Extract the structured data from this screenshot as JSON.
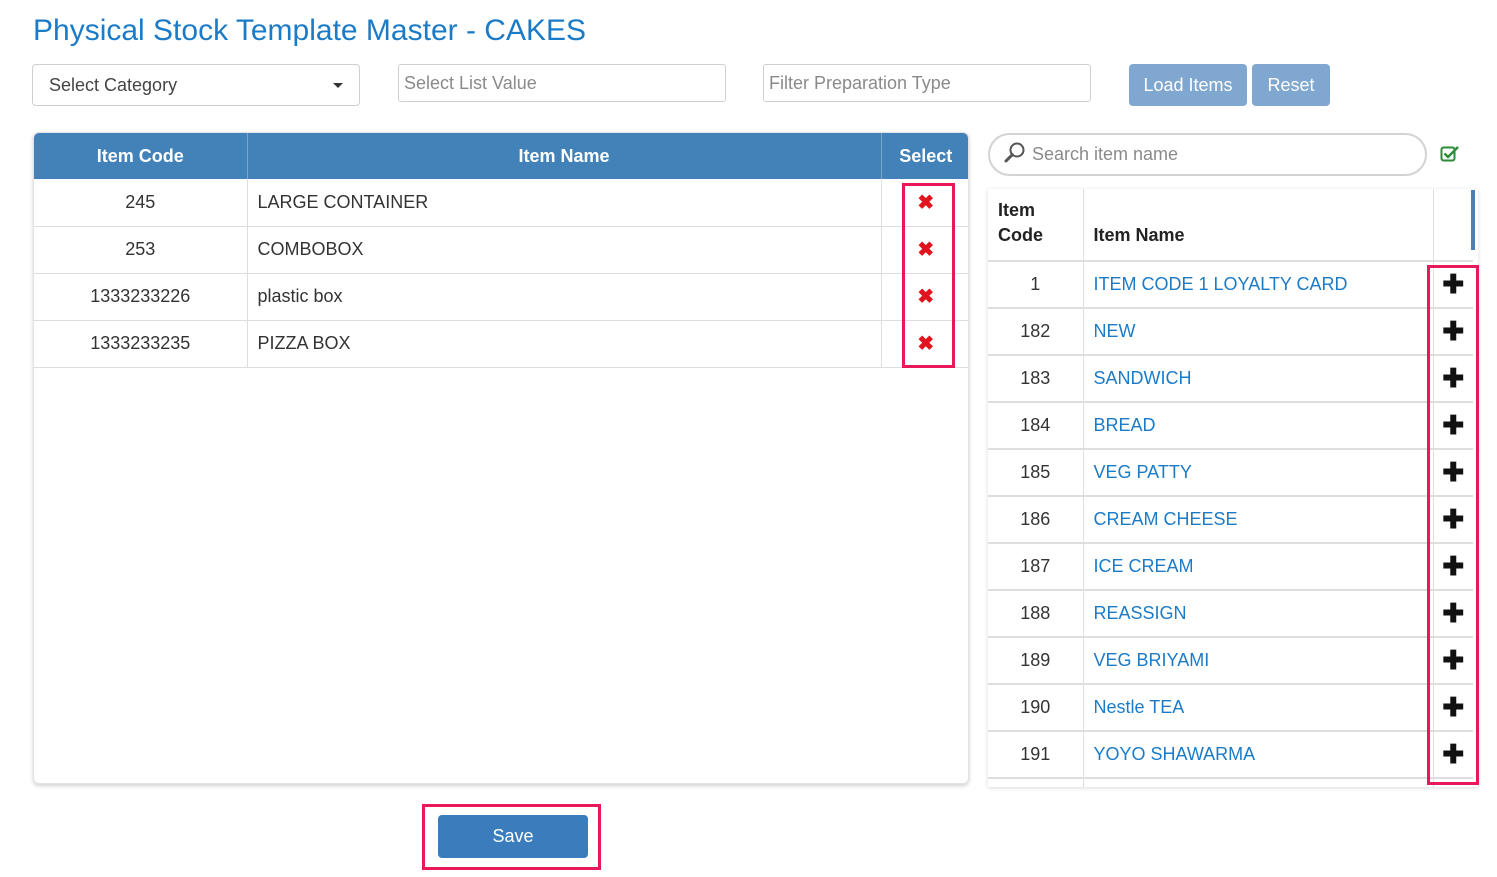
{
  "header": {
    "title": "Physical Stock Template Master - CAKES"
  },
  "filters": {
    "category_label": "Select Category",
    "list_value_placeholder": "Select List Value",
    "prep_type_placeholder": "Filter Preparation Type",
    "load_label": "Load Items",
    "reset_label": "Reset"
  },
  "selected_table": {
    "columns": [
      "Item Code",
      "Item Name",
      "Select"
    ],
    "rows": [
      {
        "code": "245",
        "name": "LARGE CONTAINER"
      },
      {
        "code": "253",
        "name": "COMBOBOX"
      },
      {
        "code": "1333233226",
        "name": "plastic box"
      },
      {
        "code": "1333233235",
        "name": "PIZZA BOX"
      }
    ],
    "remove_glyph": "✖"
  },
  "search": {
    "placeholder": "Search item name"
  },
  "available_table": {
    "columns": [
      "Item Code",
      "Item Name"
    ],
    "rows": [
      {
        "code": "1",
        "name": "ITEM CODE 1 LOYALTY CARD"
      },
      {
        "code": "182",
        "name": "NEW"
      },
      {
        "code": "183",
        "name": "SANDWICH"
      },
      {
        "code": "184",
        "name": "BREAD"
      },
      {
        "code": "185",
        "name": "VEG PATTY"
      },
      {
        "code": "186",
        "name": "CREAM CHEESE"
      },
      {
        "code": "187",
        "name": "ICE CREAM"
      },
      {
        "code": "188",
        "name": "REASSIGN"
      },
      {
        "code": "189",
        "name": "VEG BRIYAMI"
      },
      {
        "code": "190",
        "name": "Nestle TEA"
      },
      {
        "code": "191",
        "name": "YOYO SHAWARMA"
      }
    ],
    "add_glyph": "✚"
  },
  "footer": {
    "save_label": "Save"
  },
  "colors": {
    "brand": "#1c7bc7",
    "header_bg": "#4382b8",
    "highlight": "#e8185a",
    "remove": "#e0141e"
  }
}
